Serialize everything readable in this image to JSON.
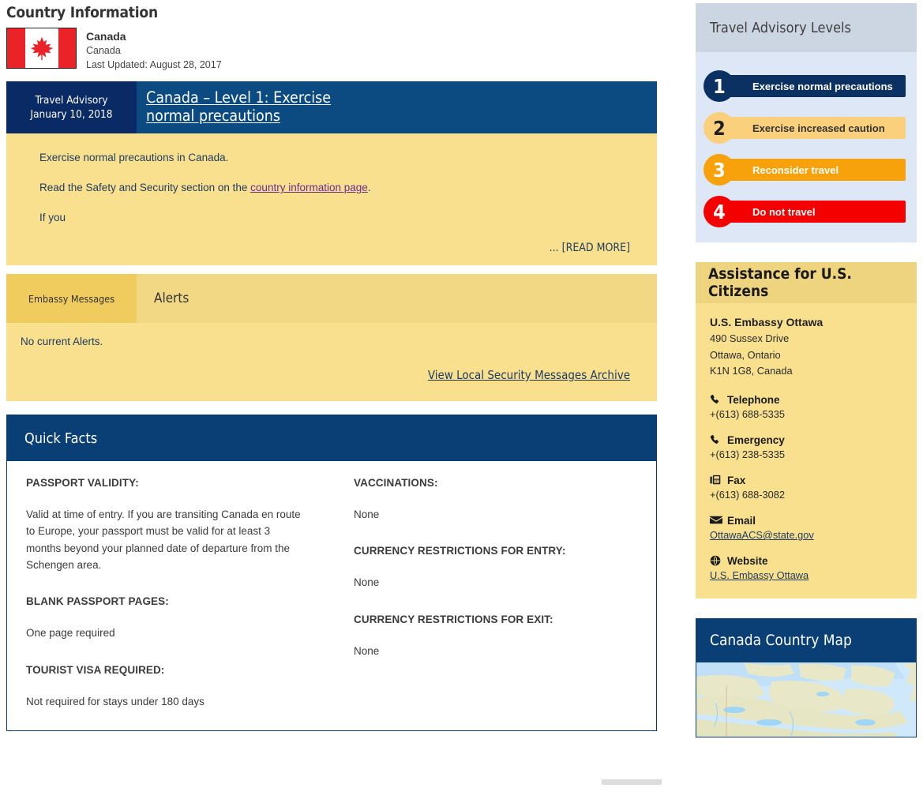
{
  "page": {
    "title": "Country Information"
  },
  "country": {
    "flag_icon": "canada-flag",
    "name": "Canada",
    "subtitle": "Canada",
    "last_updated": "Last Updated: August 28, 2017"
  },
  "advisory": {
    "label": "Travel Advisory",
    "date": "January 10, 2018",
    "title": "Canada – Level 1: Exercise normal precautions",
    "paragraphs": [
      "Exercise normal precautions in Canada.",
      "If you"
    ],
    "security_line_prefix": "Read the Safety and Security section on the ",
    "security_link": "country information page",
    "security_line_suffix": ".",
    "read_more": "... [READ MORE]"
  },
  "alerts": {
    "tab_inactive": "Embassy Messages",
    "tab_active": "Alerts",
    "empty_text": "No current Alerts.",
    "archive_link": "View Local Security Messages Archive"
  },
  "quick_facts": {
    "heading": "Quick Facts",
    "left": [
      {
        "term": "PASSPORT VALIDITY:",
        "value": "Valid at time of entry. If you are transiting Canada en route to Europe, your passport must be valid for at least 3 months beyond your planned date of departure from the Schengen area."
      },
      {
        "term": "BLANK PASSPORT PAGES:",
        "value": "One page required"
      },
      {
        "term": "TOURIST VISA REQUIRED:",
        "value": "Not required for stays under 180 days"
      }
    ],
    "right": [
      {
        "term": "VACCINATIONS:",
        "value": "None"
      },
      {
        "term": "CURRENCY RESTRICTIONS FOR ENTRY:",
        "value": "None"
      },
      {
        "term": "CURRENCY RESTRICTIONS FOR EXIT:",
        "value": "None"
      }
    ]
  },
  "levels_panel": {
    "heading": "Travel Advisory Levels",
    "levels": [
      {
        "number": "1",
        "label": "Exercise normal precautions",
        "bar_color": "#0a3161",
        "badge_color": "#0a3161",
        "text_color": "#ffffff",
        "number_color": "#ffffff"
      },
      {
        "number": "2",
        "label": "Exercise increased caution",
        "bar_color": "#fbd07c",
        "badge_color": "#fbd07c",
        "text_color": "#333333",
        "number_color": "#231f20"
      },
      {
        "number": "3",
        "label": "Reconsider travel",
        "bar_color": "#f7a20b",
        "badge_color": "#f7a20b",
        "text_color": "#ffffff",
        "number_color": "#ffffff"
      },
      {
        "number": "4",
        "label": "Do not travel",
        "bar_color": "#f50000",
        "badge_color": "#f50000",
        "text_color": "#ffffff",
        "number_color": "#ffffff"
      }
    ]
  },
  "assistance": {
    "heading": "Assistance for U.S. Citizens",
    "embassy_name": "U.S. Embassy Ottawa",
    "address": [
      "490 Sussex Drive",
      "Ottawa, Ontario",
      "K1N 1G8, Canada"
    ],
    "contacts": [
      {
        "icon": "phone-icon",
        "label": "Telephone",
        "value": "+(613) 688-5335",
        "is_link": false
      },
      {
        "icon": "phone-icon",
        "label": "Emergency",
        "value": "+(613) 238-5335",
        "is_link": false
      },
      {
        "icon": "fax-icon",
        "label": "Fax",
        "value": "+(613) 688-3082",
        "is_link": false
      },
      {
        "icon": "envelope-icon",
        "label": "Email",
        "value": "OttawaACS@state.gov",
        "is_link": true
      },
      {
        "icon": "globe-icon",
        "label": "Website",
        "value": "U.S. Embassy Ottawa",
        "is_link": true
      }
    ]
  },
  "map_panel": {
    "heading": "Canada Country Map",
    "map_icon": "canada-country-map"
  }
}
